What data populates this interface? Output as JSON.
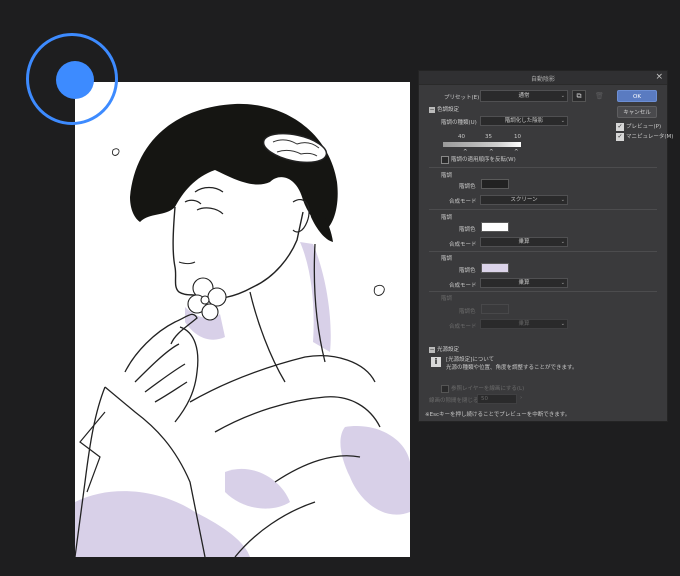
{
  "dialog": {
    "title": "自動陰影",
    "close_glyph": "×",
    "preset": {
      "label": "プリセット(E)",
      "value": "通常",
      "chevron": "⌄"
    },
    "color_settings": {
      "section_label": "色調設定",
      "type_label": "階調の種類(U)",
      "type_value": "階調化した陰影",
      "gradient_values": [
        "40",
        "35",
        "10"
      ],
      "apply_order_label": "階調の適用順序を反転(W)"
    },
    "groups": [
      {
        "title": "階調",
        "color_label": "階調色",
        "blend_label": "合成モード",
        "blend_value": "スクリーン",
        "swatch_color": "#222222",
        "enabled": true
      },
      {
        "title": "階調",
        "color_label": "階調色",
        "blend_label": "合成モード",
        "blend_value": "乗算",
        "swatch_color": "#ffffff",
        "enabled": true
      },
      {
        "title": "階調",
        "color_label": "階調色",
        "blend_label": "合成モード",
        "blend_value": "乗算",
        "swatch_color": "#dcd4ea",
        "enabled": true
      },
      {
        "title": "階調",
        "color_label": "階調色",
        "blend_label": "合成モード",
        "blend_value": "乗算",
        "swatch_color": "#3a3a3c",
        "enabled": false
      }
    ],
    "light_settings": {
      "section_label": "光源設定",
      "info_line1": "[光源設定]について",
      "info_line2": "光源の種類や位置、角度を調整することができます。"
    },
    "ref_layer_label": "参照レイヤーを線画にする(L)",
    "line_gap_label": "線画の隙間を閉じる",
    "line_gap_value": "50",
    "footer_note": "※Escキーを押し続けることでプレビューを中断できます。",
    "buttons": {
      "ok": "OK",
      "cancel": "キャンセル"
    },
    "checkboxes": [
      {
        "label": "プレビュー(P)",
        "checked": true
      },
      {
        "label": "マニピュレータ(M)",
        "checked": true
      }
    ]
  },
  "colors": {
    "cursor": "#3d8bff",
    "shadow_lavender": "#d8d0e8",
    "ok_button": "#5a7bc1"
  },
  "icons": {
    "preset_new": "new-preset-icon",
    "preset_delete": "trash-icon",
    "info": "info-icon",
    "cursor": "pen-cursor-icon"
  }
}
